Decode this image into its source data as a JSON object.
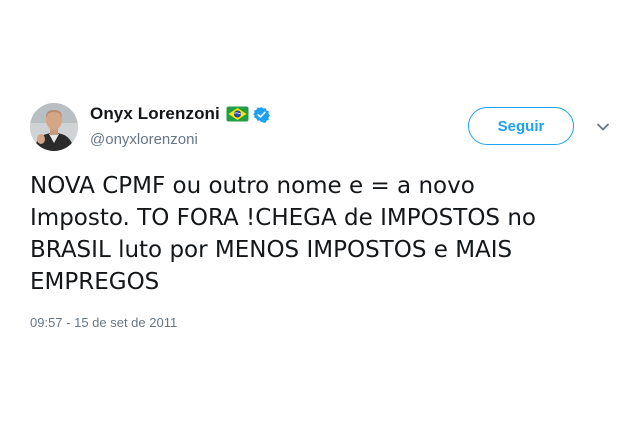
{
  "author": {
    "display_name": "Onyx Lorenzoni",
    "handle": "@onyxlorenzoni",
    "flag_icon": "brazil-flag-icon",
    "verified_icon": "verified-badge-icon",
    "avatar": "profile-photo"
  },
  "follow_button": {
    "label": "Seguir"
  },
  "menu_icon": "chevron-down-icon",
  "tweet": {
    "text": "NOVA CPMF ou outro nome e = a novo\nImposto. TO FORA !CHEGA de IMPOSTOS no\nBRASIL luto por MENOS IMPOSTOS e MAIS\nEMPREGOS",
    "timestamp": "09:57 - 15 de set de 2011"
  },
  "colors": {
    "accent": "#1da1f2",
    "text": "#14171a",
    "muted": "#657786"
  }
}
